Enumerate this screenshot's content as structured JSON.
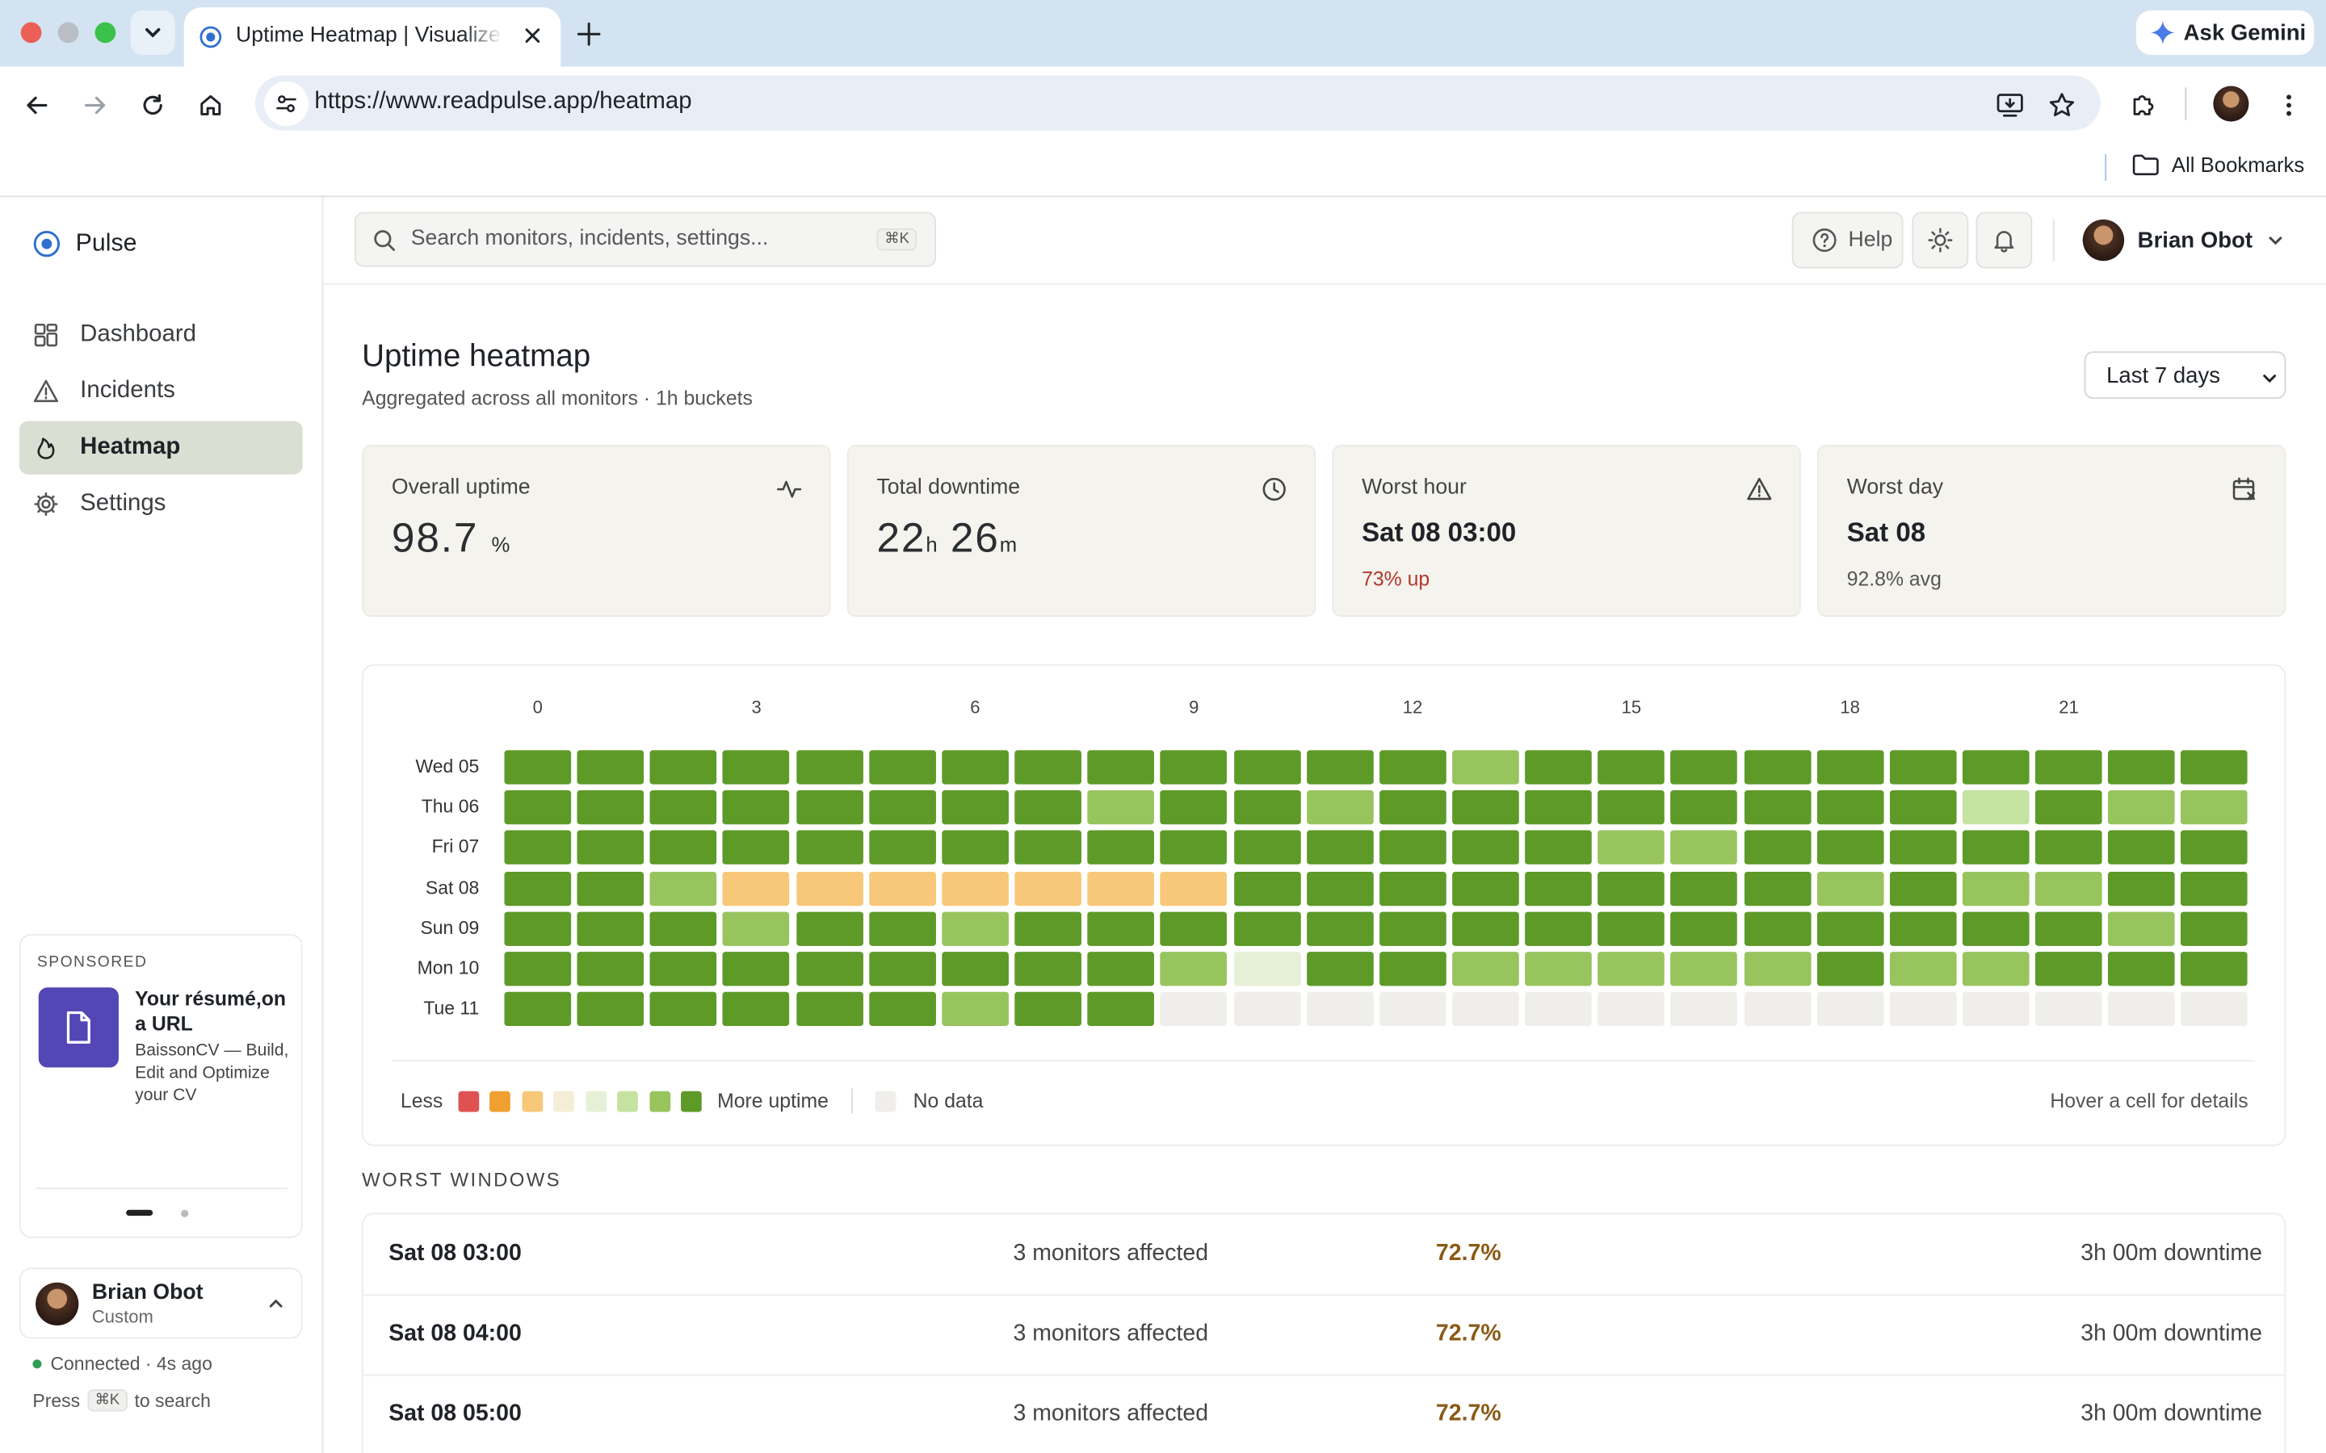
{
  "browser": {
    "tab_title": "Uptime Heatmap | Visualize Monitor Uptime",
    "url": "https://www.readpulse.app/heatmap",
    "gemini_label": "Ask Gemini",
    "bookmarks_label": "All Bookmarks"
  },
  "sidebar": {
    "brand": "Pulse",
    "items": [
      {
        "label": "Dashboard",
        "icon": "grid-icon"
      },
      {
        "label": "Incidents",
        "icon": "warning-icon"
      },
      {
        "label": "Heatmap",
        "icon": "flame-icon"
      },
      {
        "label": "Settings",
        "icon": "gear-icon"
      }
    ],
    "active": "Heatmap",
    "sponsor": {
      "label": "SPONSORED",
      "headline": "Your résumé,on a URL",
      "description": "BaissonCV — Build, Edit and Optimize your CV"
    },
    "user": {
      "name": "Brian Obot",
      "plan": "Custom"
    },
    "status": "Connected · 4s ago",
    "hint": {
      "prefix": "Press",
      "key": "⌘K",
      "suffix": "to search"
    }
  },
  "topbar": {
    "search_placeholder": "Search monitors, incidents, settings...",
    "search_shortcut": "⌘K",
    "help_label": "Help",
    "user_name": "Brian Obot"
  },
  "page": {
    "title": "Uptime heatmap",
    "subtitle": "Aggregated across all monitors · 1h buckets",
    "range": "Last 7 days"
  },
  "stats": {
    "overall_uptime": {
      "label": "Overall uptime",
      "value": "98.7",
      "unit": "%"
    },
    "total_downtime": {
      "label": "Total downtime",
      "hours": "22",
      "h_unit": "h",
      "minutes": "26",
      "m_unit": "m"
    },
    "worst_hour": {
      "label": "Worst hour",
      "value": "Sat 08 03:00",
      "note": "73% up"
    },
    "worst_day": {
      "label": "Worst day",
      "value": "Sat 08",
      "note": "92.8% avg"
    }
  },
  "heatmap": {
    "hour_labels": [
      "0",
      "3",
      "6",
      "9",
      "12",
      "15",
      "18",
      "21"
    ],
    "days": [
      "Wed 05",
      "Thu 06",
      "Fri 07",
      "Sat 08",
      "Sun 09",
      "Mon 10",
      "Tue 11"
    ],
    "level_colors": [
      "#e05252",
      "#f0a030",
      "#f8c87a",
      "#f5edd6",
      "#e6f0d6",
      "#c6e2a0",
      "#98c45e",
      "#5e9a28"
    ],
    "nodata_color": "#efeeeb",
    "levels": [
      [
        7,
        7,
        7,
        7,
        7,
        7,
        7,
        7,
        7,
        7,
        7,
        7,
        7,
        6,
        7,
        7,
        7,
        7,
        7,
        7,
        7,
        7,
        7,
        7
      ],
      [
        7,
        7,
        7,
        7,
        7,
        7,
        7,
        7,
        6,
        7,
        7,
        6,
        7,
        7,
        7,
        7,
        7,
        7,
        7,
        7,
        5,
        7,
        6,
        6
      ],
      [
        7,
        7,
        7,
        7,
        7,
        7,
        7,
        7,
        7,
        7,
        7,
        7,
        7,
        7,
        7,
        6,
        6,
        7,
        7,
        7,
        7,
        7,
        7,
        7
      ],
      [
        7,
        7,
        6,
        2,
        2,
        2,
        2,
        2,
        2,
        2,
        7,
        7,
        7,
        7,
        7,
        7,
        7,
        7,
        6,
        7,
        6,
        6,
        7,
        7
      ],
      [
        7,
        7,
        7,
        6,
        7,
        7,
        6,
        7,
        7,
        7,
        7,
        7,
        7,
        7,
        7,
        7,
        7,
        7,
        7,
        7,
        7,
        7,
        6,
        7
      ],
      [
        7,
        7,
        7,
        7,
        7,
        7,
        7,
        7,
        7,
        6,
        4,
        7,
        7,
        6,
        6,
        6,
        6,
        6,
        7,
        6,
        6,
        7,
        7,
        7
      ],
      [
        7,
        7,
        7,
        7,
        7,
        7,
        6,
        7,
        7,
        -1,
        -1,
        -1,
        -1,
        -1,
        -1,
        -1,
        -1,
        -1,
        -1,
        -1,
        -1,
        -1,
        -1,
        -1
      ]
    ],
    "legend_less": "Less",
    "legend_more": "More uptime",
    "legend_nodata": "No data",
    "hint": "Hover a cell for details"
  },
  "worst_windows": {
    "title": "WORST WINDOWS",
    "rows": [
      {
        "time": "Sat 08 03:00",
        "monitors": "3 monitors affected",
        "pct": "72.7%",
        "downtime": "3h 00m downtime"
      },
      {
        "time": "Sat 08 04:00",
        "monitors": "3 monitors affected",
        "pct": "72.7%",
        "downtime": "3h 00m downtime"
      },
      {
        "time": "Sat 08 05:00",
        "monitors": "3 monitors affected",
        "pct": "72.7%",
        "downtime": "3h 00m downtime"
      }
    ]
  }
}
